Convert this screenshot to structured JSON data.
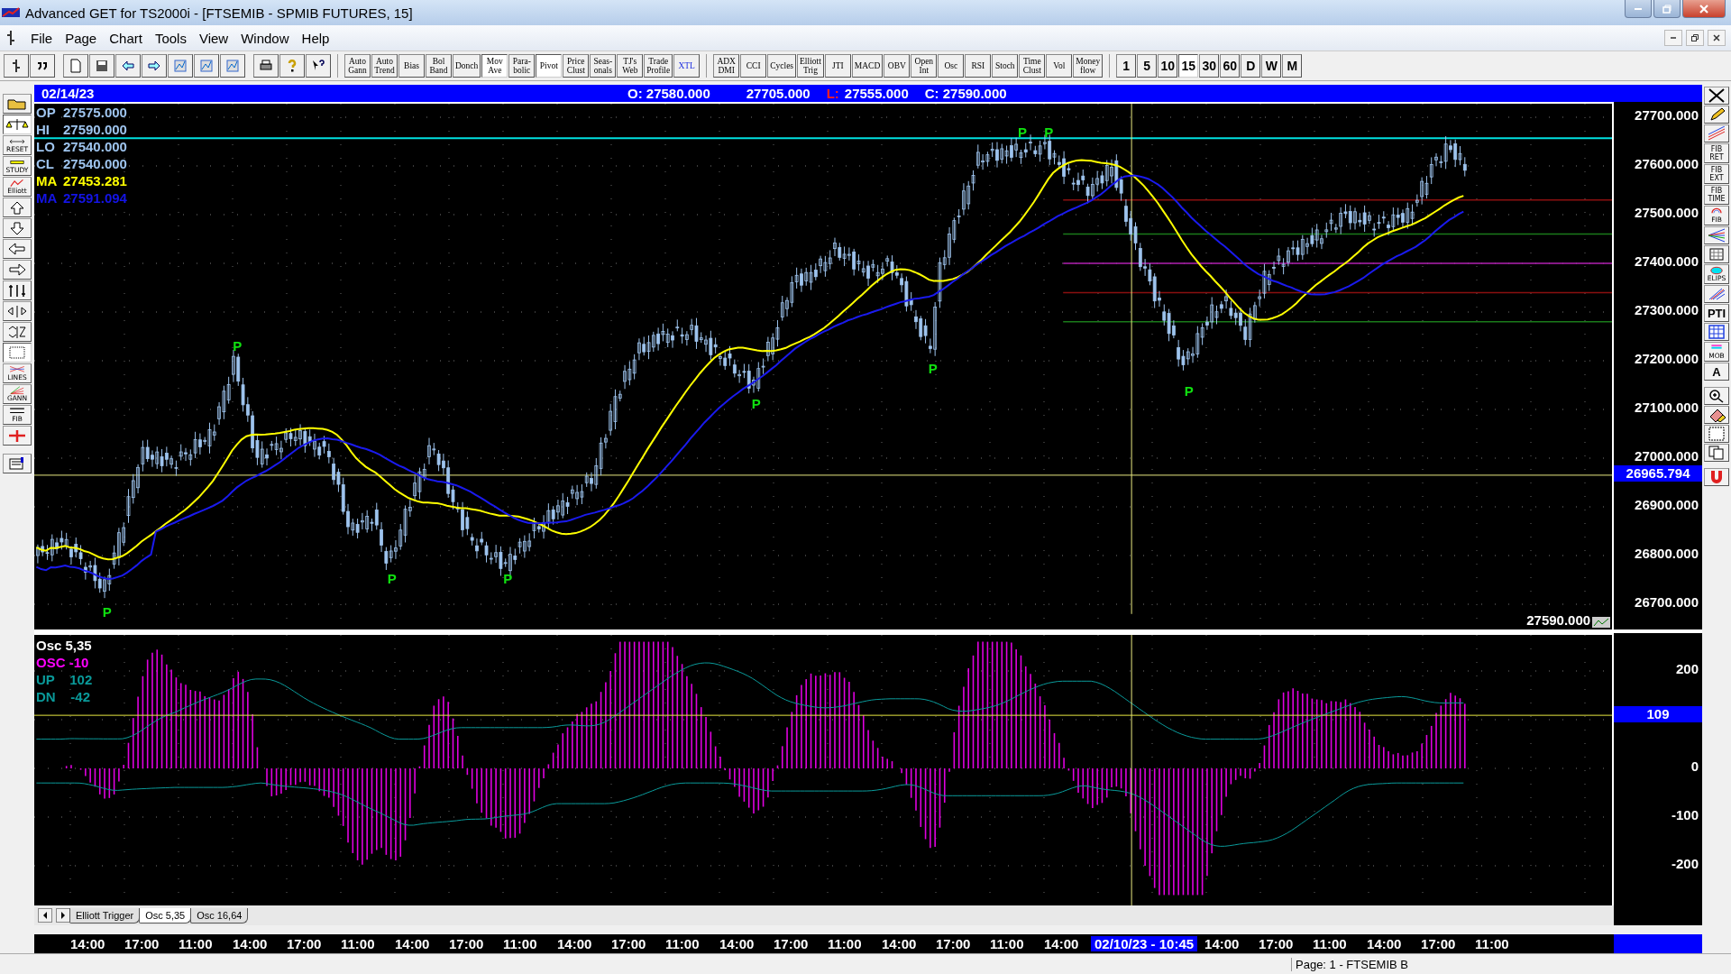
{
  "window": {
    "title": "Advanced GET for TS2000i - [FTSEMIB - SPMIB FUTURES, 15]"
  },
  "menu": [
    "File",
    "Page",
    "Chart",
    "Tools",
    "View",
    "Window",
    "Help"
  ],
  "study_buttons": [
    {
      "label": "Auto\nGann",
      "selected": false
    },
    {
      "label": "Auto\nTrend",
      "selected": false
    },
    {
      "label": "Bias",
      "selected": false
    },
    {
      "label": "Bol\nBand",
      "selected": false
    },
    {
      "label": "Donch",
      "selected": false
    },
    {
      "label": "Mov\nAve",
      "selected": true
    },
    {
      "label": "Para-\nbolic",
      "selected": false
    },
    {
      "label": "Pivot",
      "selected": true
    },
    {
      "label": "Price\nClust",
      "selected": false
    },
    {
      "label": "Seas-\nonals",
      "selected": false
    },
    {
      "label": "TJ's\nWeb",
      "selected": false
    },
    {
      "label": "Trade\nProfile",
      "selected": false
    },
    {
      "label": "XTL",
      "selected": false
    }
  ],
  "indicator_buttons": [
    {
      "label": "ADX\nDMI",
      "selected": false
    },
    {
      "label": "CCI",
      "selected": false
    },
    {
      "label": "Cycles",
      "selected": false
    },
    {
      "label": "Elliott\nTrig",
      "selected": false
    },
    {
      "label": "JTI",
      "selected": false
    },
    {
      "label": "MACD",
      "selected": false
    },
    {
      "label": "OBV",
      "selected": false
    },
    {
      "label": "Open\nInt",
      "selected": false
    },
    {
      "label": "Osc",
      "selected": false
    },
    {
      "label": "RSI",
      "selected": false
    },
    {
      "label": "Stoch",
      "selected": false
    },
    {
      "label": "Time\nClust",
      "selected": false
    },
    {
      "label": "Vol",
      "selected": false
    },
    {
      "label": "Money\nflow",
      "selected": false
    }
  ],
  "intervals": [
    {
      "label": "1",
      "selected": false
    },
    {
      "label": "5",
      "selected": false
    },
    {
      "label": "10",
      "selected": false
    },
    {
      "label": "15",
      "selected": true
    },
    {
      "label": "30",
      "selected": false
    },
    {
      "label": "60",
      "selected": false
    },
    {
      "label": "D",
      "selected": false
    },
    {
      "label": "W",
      "selected": false
    },
    {
      "label": "M",
      "selected": false
    }
  ],
  "left_tools": [
    {
      "kind": "open"
    },
    {
      "kind": "scales",
      "selected": true
    },
    {
      "kind": "reset",
      "label": "RESET"
    },
    {
      "kind": "study",
      "label": "STUDY"
    },
    {
      "kind": "elliott",
      "label": "Elliott"
    },
    {
      "kind": "up"
    },
    {
      "kind": "down"
    },
    {
      "kind": "left"
    },
    {
      "kind": "right"
    },
    {
      "kind": "vzoom"
    },
    {
      "kind": "hzoom"
    },
    {
      "kind": "vfit"
    },
    {
      "kind": "grid",
      "selected": true
    },
    {
      "kind": "lines",
      "label": "LINES"
    },
    {
      "kind": "gann",
      "label": "GANN"
    },
    {
      "kind": "fib",
      "label": "FIB"
    },
    {
      "kind": "cross"
    },
    {
      "kind": "props"
    }
  ],
  "right_tools": [
    {
      "kind": "close"
    },
    {
      "kind": "pencil"
    },
    {
      "kind": "channel"
    },
    {
      "kind": "text",
      "label": "FIB\nRET"
    },
    {
      "kind": "text",
      "label": "FIB\nEXT"
    },
    {
      "kind": "text",
      "label": "FIB\nTIME"
    },
    {
      "kind": "arc",
      "label": "FIB"
    },
    {
      "kind": "fan"
    },
    {
      "kind": "grid"
    },
    {
      "kind": "ellipse",
      "label": "ELIPS"
    },
    {
      "kind": "pitch"
    },
    {
      "kind": "bold",
      "label": "PTI"
    },
    {
      "kind": "table"
    },
    {
      "kind": "mob",
      "label": "MOB"
    },
    {
      "kind": "bold",
      "label": "A"
    },
    {
      "kind": "zoom"
    },
    {
      "kind": "eraser"
    },
    {
      "kind": "pattern"
    },
    {
      "kind": "copy"
    },
    {
      "kind": "magnet"
    }
  ],
  "header": {
    "date": "02/14/23",
    "open": "O: 27580.000",
    "high": "27705.000",
    "low_label": "L:",
    "low": "27555.000",
    "close": "C: 27590.000"
  },
  "legend": [
    {
      "label": "OP",
      "value": "27575.000",
      "color": "#9ec4ee"
    },
    {
      "label": "HI",
      "value": "27590.000",
      "color": "#9ec4ee"
    },
    {
      "label": "LO",
      "value": "27540.000",
      "color": "#9ec4ee"
    },
    {
      "label": "CL",
      "value": "27540.000",
      "color": "#9ec4ee"
    },
    {
      "label": "MA",
      "value": "27453.281",
      "color": "#ffff00"
    },
    {
      "label": "MA",
      "value": "27591.094",
      "color": "#1414e6"
    }
  ],
  "price_axis": [
    "27700.000",
    "27600.000",
    "27500.000",
    "27400.000",
    "27300.000",
    "27200.000",
    "27100.000",
    "27000.000",
    "26900.000",
    "26800.000",
    "26700.000"
  ],
  "price_cursor": "26965.794",
  "last_price": "27590.000",
  "pivot_marks": [
    "P",
    "P",
    "P",
    "P",
    "P",
    "P",
    "P",
    "P",
    "P"
  ],
  "osc_legend": [
    {
      "text": "Osc 5,35",
      "color": "#ffffff"
    },
    {
      "text": "OSC -10",
      "color": "#ff00ff"
    },
    {
      "text": "UP    102",
      "color": "#0a9a9a"
    },
    {
      "text": "DN    -42",
      "color": "#0a9a9a"
    }
  ],
  "osc_axis": [
    "200",
    "0",
    "-100",
    "-200"
  ],
  "osc_cursor": "109",
  "tabs": [
    {
      "label": "Elliott Trigger",
      "selected": false
    },
    {
      "label": "Osc 5,35",
      "selected": true
    },
    {
      "label": "Osc 16,64",
      "selected": false
    }
  ],
  "time_axis": [
    {
      "label": "14:00",
      "kind": "tick"
    },
    {
      "label": "17:00",
      "kind": "tick"
    },
    {
      "label": "11:00",
      "kind": "tick"
    },
    {
      "label": "14:00",
      "kind": "tick"
    },
    {
      "label": "17:00",
      "kind": "tick"
    },
    {
      "label": "11:00",
      "kind": "tick"
    },
    {
      "label": "14:00",
      "kind": "tick"
    },
    {
      "label": "17:00",
      "kind": "tick"
    },
    {
      "label": "11:00",
      "kind": "tick"
    },
    {
      "label": "14:00",
      "kind": "tick"
    },
    {
      "label": "17:00",
      "kind": "tick"
    },
    {
      "label": "11:00",
      "kind": "tick"
    },
    {
      "label": "14:00",
      "kind": "tick"
    },
    {
      "label": "17:00",
      "kind": "tick"
    },
    {
      "label": "11:00",
      "kind": "tick"
    },
    {
      "label": "14:00",
      "kind": "tick"
    },
    {
      "label": "17:00",
      "kind": "tick"
    },
    {
      "label": "11:00",
      "kind": "tick"
    },
    {
      "label": "14:00",
      "kind": "tick"
    },
    {
      "label": "02/10/23 - 10:45",
      "kind": "cursor"
    },
    {
      "label": "14:00",
      "kind": "tick"
    },
    {
      "label": "17:00",
      "kind": "tick"
    },
    {
      "label": "11:00",
      "kind": "tick"
    },
    {
      "label": "14:00",
      "kind": "tick"
    },
    {
      "label": "17:00",
      "kind": "tick"
    },
    {
      "label": "11:00",
      "kind": "tick"
    }
  ],
  "status_bar": "Page: 1 - FTSEMIB B"
}
